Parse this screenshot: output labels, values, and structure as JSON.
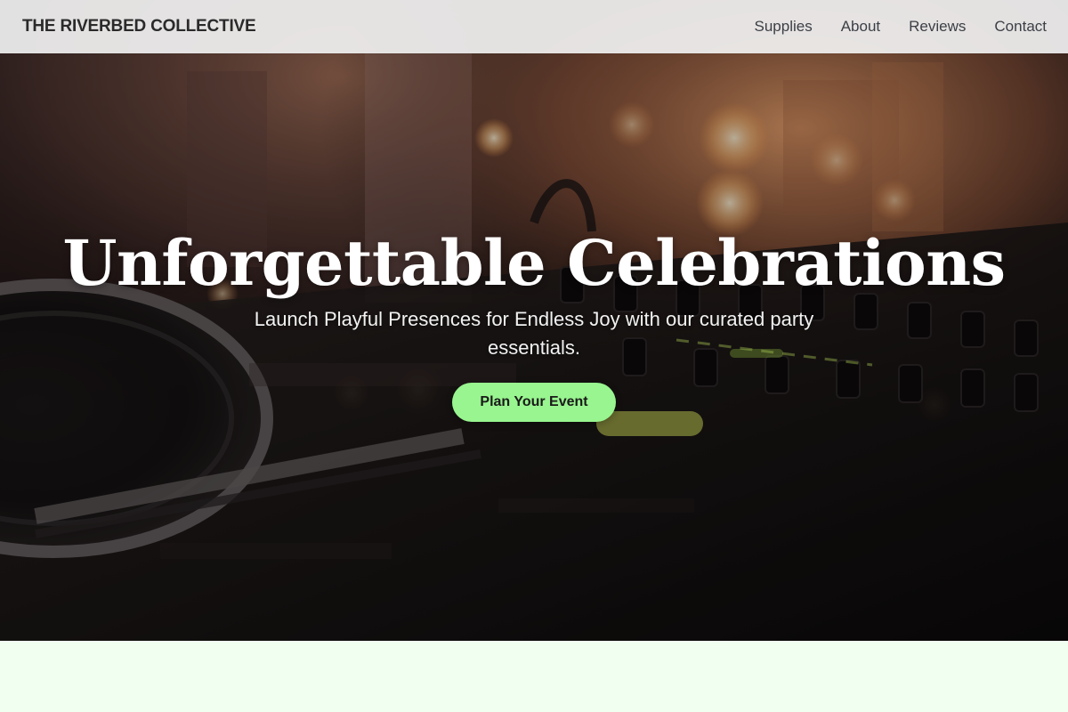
{
  "header": {
    "brand": "THE RIVERBED COLLECTIVE",
    "nav": [
      "Supplies",
      "About",
      "Reviews",
      "Contact"
    ]
  },
  "hero": {
    "title": "Unforgettable Celebrations",
    "subtitle": "Launch Playful Presences for Endless Joy with our curated party essentials.",
    "cta_label": "Plan Your Event",
    "background_image": "dj-mixer-turntable-photo"
  },
  "colors": {
    "cta": "#98f58f",
    "header_bg": "#f0f0f0",
    "section_bg": "#f0fff0",
    "hero_dark": "#140f10"
  }
}
